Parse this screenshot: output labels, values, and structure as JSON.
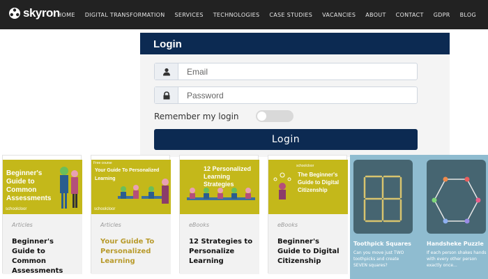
{
  "brand": {
    "name": "skyron"
  },
  "nav": [
    "HOME",
    "DIGITAL TRANSFORMATION",
    "SERVICES",
    "TECHNOLOGIES",
    "CASE STUDIES",
    "VACANCIES",
    "ABOUT",
    "CONTACT",
    "GDPR",
    "BLOG"
  ],
  "login": {
    "heading": "Login",
    "email_placeholder": "Email",
    "password_placeholder": "Password",
    "remember_label": "Remember my login",
    "remember_on": false,
    "button": "Login"
  },
  "cards": [
    {
      "thumb_title": "Beginner's Guide to Common Assessments",
      "thumb_small": "",
      "thumb_brand": "schoolcloor",
      "category": "Articles",
      "title": "Beginner's Guide to Common Assessments",
      "accent": false
    },
    {
      "thumb_title": "Your Guide To Personalized Learning",
      "thumb_small": "Free course",
      "thumb_brand": "schoolcloor",
      "category": "Articles",
      "title": "Your Guide To Personalized Learning",
      "accent": true
    },
    {
      "thumb_title": "12 Personalized Learning Strategies",
      "thumb_small": "",
      "thumb_brand": "",
      "category": "eBooks",
      "title": "12 Strategies to Personalize Learning",
      "accent": false
    },
    {
      "thumb_title": "The Beginner's Guide to Digital Citizenship",
      "thumb_small": "schoolcloor",
      "thumb_brand": "",
      "category": "eBooks",
      "title": "Beginner's Guide to Digital Citizenship",
      "accent": false
    }
  ],
  "puzzles": [
    {
      "title": "Toothpick Squares",
      "desc": "Can you move just TWO toothpicks and create SEVEN squares?"
    },
    {
      "title": "Handsheke Puzzle",
      "desc": "If each person shakes hands with every other person exactly once..."
    }
  ],
  "colors": {
    "navbar": "#222222",
    "login_header": "#0c2a52",
    "card_thumb": "#c4b81a",
    "accent_title": "#b89a2b",
    "puzzle_bg": "#8fbcd0",
    "puzzle_tile": "#466571"
  }
}
